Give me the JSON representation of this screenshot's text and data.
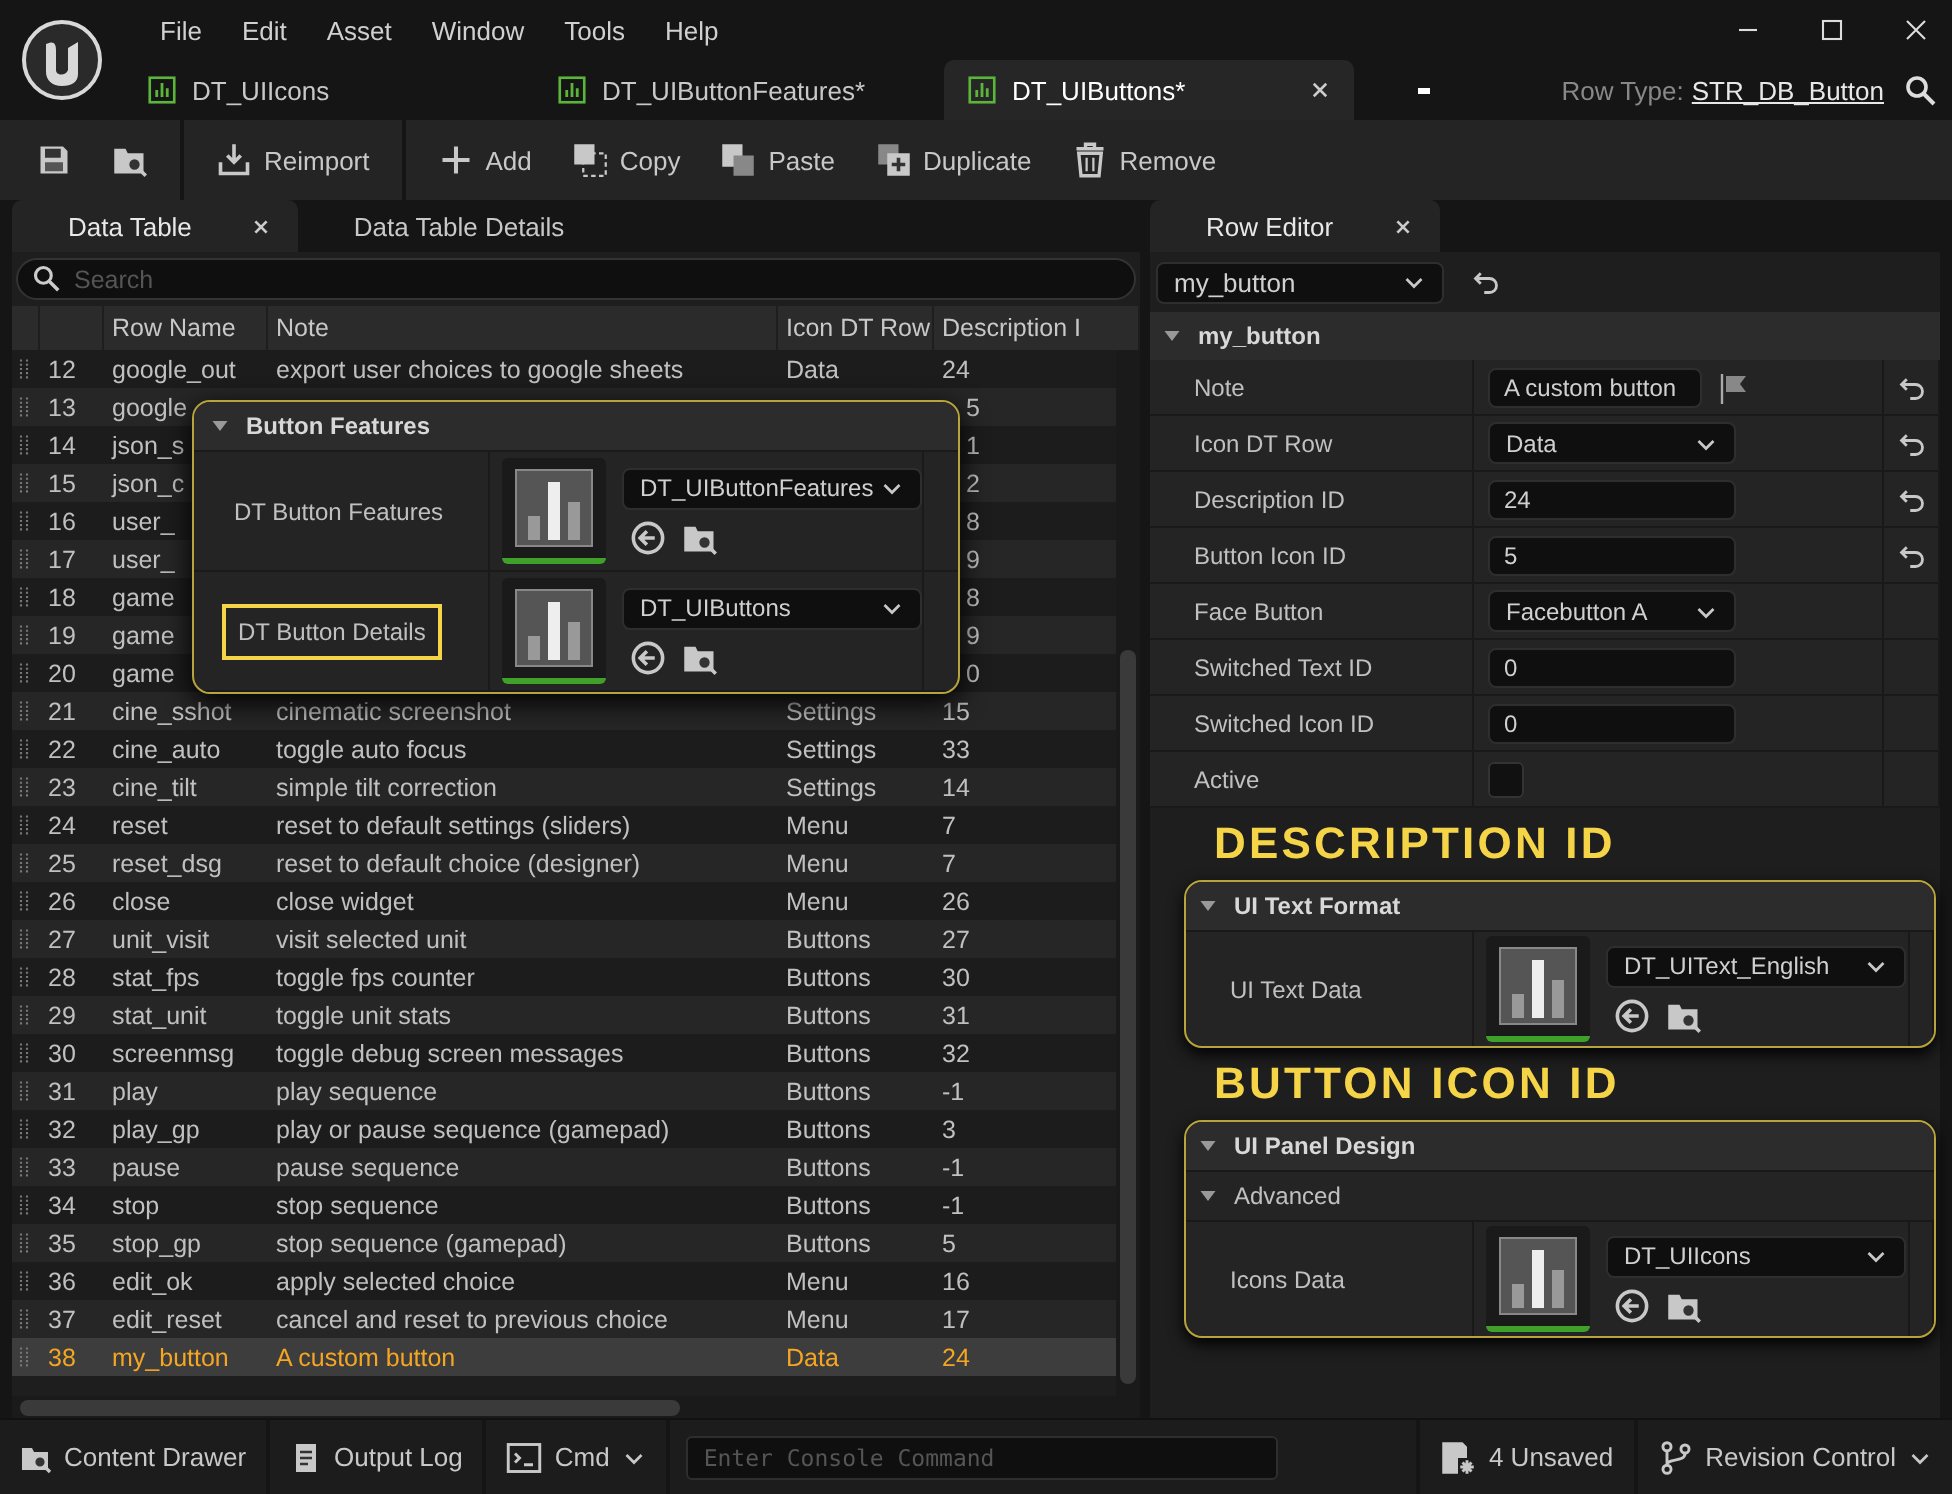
{
  "menu": [
    "File",
    "Edit",
    "Asset",
    "Window",
    "Tools",
    "Help"
  ],
  "document_tabs": [
    {
      "label": "DT_UIIcons",
      "selected": false
    },
    {
      "label": "DT_UIButtonFeatures*",
      "selected": false
    },
    {
      "label": "DT_UIButtons*",
      "selected": true
    }
  ],
  "row_type": {
    "label": "Row Type:",
    "value": "STR_DB_Button"
  },
  "toolbar": [
    {
      "kind": "save"
    },
    {
      "kind": "browse"
    },
    {
      "kind": "reimport",
      "label": "Reimport"
    },
    {
      "kind": "add",
      "label": "Add"
    },
    {
      "kind": "copy",
      "label": "Copy"
    },
    {
      "kind": "paste",
      "label": "Paste"
    },
    {
      "kind": "duplicate",
      "label": "Duplicate"
    },
    {
      "kind": "remove",
      "label": "Remove"
    }
  ],
  "data_table": {
    "tabs": [
      {
        "label": "Data Table",
        "selected": true
      },
      {
        "label": "Data Table Details",
        "selected": false
      }
    ],
    "search": {
      "placeholder": "Search"
    },
    "columns": [
      "Row Name",
      "Note",
      "Icon DT Row",
      "Description I"
    ],
    "rows": [
      {
        "number": "12",
        "name": "google_out",
        "note": "export user choices to google sheets",
        "icon_row": "Data",
        "description_id": "24",
        "selected": false
      },
      {
        "number": "13",
        "name": "google",
        "description_id": "5",
        "selected": false
      },
      {
        "number": "14",
        "name": "json_s",
        "description_id": "1",
        "selected": false
      },
      {
        "number": "15",
        "name": "json_c",
        "description_id": "2",
        "selected": false
      },
      {
        "number": "16",
        "name": "user_",
        "description_id": "8",
        "selected": false
      },
      {
        "number": "17",
        "name": "user_",
        "description_id": "9",
        "selected": false
      },
      {
        "number": "18",
        "name": "game",
        "description_id": "8",
        "selected": false
      },
      {
        "number": "19",
        "name": "game",
        "description_id": "9",
        "selected": false
      },
      {
        "number": "20",
        "name": "game",
        "description_id": "0",
        "selected": false
      },
      {
        "number": "21",
        "name": "cine_sshot",
        "note": "cinematic screenshot",
        "icon_row": "Settings",
        "description_id": "15",
        "selected": false
      },
      {
        "number": "22",
        "name": "cine_auto",
        "note": "toggle auto focus",
        "icon_row": "Settings",
        "description_id": "33",
        "selected": false
      },
      {
        "number": "23",
        "name": "cine_tilt",
        "note": "simple tilt correction",
        "icon_row": "Settings",
        "description_id": "14",
        "selected": false
      },
      {
        "number": "24",
        "name": "reset",
        "note": "reset to default settings (sliders)",
        "icon_row": "Menu",
        "description_id": "7",
        "selected": false
      },
      {
        "number": "25",
        "name": "reset_dsg",
        "note": "reset to default choice (designer)",
        "icon_row": "Menu",
        "description_id": "7",
        "selected": false
      },
      {
        "number": "26",
        "name": "close",
        "note": "close widget",
        "icon_row": "Menu",
        "description_id": "26",
        "selected": false
      },
      {
        "number": "27",
        "name": "unit_visit",
        "note": "visit selected unit",
        "icon_row": "Buttons",
        "description_id": "27",
        "selected": false
      },
      {
        "number": "28",
        "name": "stat_fps",
        "note": "toggle fps counter",
        "icon_row": "Buttons",
        "description_id": "30",
        "selected": false
      },
      {
        "number": "29",
        "name": "stat_unit",
        "note": "toggle unit stats",
        "icon_row": "Buttons",
        "description_id": "31",
        "selected": false
      },
      {
        "number": "30",
        "name": "screenmsg",
        "note": "toggle debug screen messages",
        "icon_row": "Buttons",
        "description_id": "32",
        "selected": false
      },
      {
        "number": "31",
        "name": "play",
        "note": "play sequence",
        "icon_row": "Buttons",
        "description_id": "-1",
        "selected": false
      },
      {
        "number": "32",
        "name": "play_gp",
        "note": "play or pause sequence (gamepad)",
        "icon_row": "Buttons",
        "description_id": "3",
        "selected": false
      },
      {
        "number": "33",
        "name": "pause",
        "note": "pause sequence",
        "icon_row": "Buttons",
        "description_id": "-1",
        "selected": false
      },
      {
        "number": "34",
        "name": "stop",
        "note": "stop sequence",
        "icon_row": "Buttons",
        "description_id": "-1",
        "selected": false
      },
      {
        "number": "35",
        "name": "stop_gp",
        "note": "stop sequence (gamepad)",
        "icon_row": "Buttons",
        "description_id": "5",
        "selected": false
      },
      {
        "number": "36",
        "name": "edit_ok",
        "note": "apply selected choice",
        "icon_row": "Menu",
        "description_id": "16",
        "selected": false
      },
      {
        "number": "37",
        "name": "edit_reset",
        "note": "cancel and reset to previous choice",
        "icon_row": "Menu",
        "description_id": "17",
        "selected": false
      },
      {
        "number": "38",
        "name": "my_button",
        "note": "A custom button",
        "icon_row": "Data",
        "description_id": "24",
        "selected": true
      }
    ]
  },
  "popup": {
    "title": "Button Features",
    "rows": [
      {
        "label": "DT Button Features",
        "value": "DT_UIButtonFeatures",
        "highlighted": false
      },
      {
        "label": "DT Button Details",
        "value": "DT_UIButtons",
        "highlighted": true
      }
    ]
  },
  "row_editor": {
    "tab": "Row Editor",
    "row_select": "my_button",
    "section": "my_button",
    "properties": [
      {
        "label": "Note",
        "kind": "text",
        "value": "A custom button",
        "flag": true,
        "resettable": true
      },
      {
        "label": "Icon DT Row",
        "kind": "dropdown",
        "value": "Data",
        "resettable": true
      },
      {
        "label": "Description ID",
        "kind": "text",
        "value": "24",
        "resettable": true
      },
      {
        "label": "Button Icon ID",
        "kind": "text",
        "value": "5",
        "resettable": true
      },
      {
        "label": "Face Button",
        "kind": "dropdown",
        "value": "Facebutton A",
        "resettable": false
      },
      {
        "label": "Switched Text ID",
        "kind": "text",
        "value": "0",
        "resettable": false
      },
      {
        "label": "Switched Icon ID",
        "kind": "text",
        "value": "0",
        "resettable": false
      },
      {
        "label": "Active",
        "kind": "checkbox",
        "checked": false,
        "resettable": false
      }
    ],
    "groups": [
      {
        "caption": "DESCRIPTION ID",
        "title": "UI Text Format",
        "asset_label": "UI Text Data",
        "asset": "DT_UIText_English"
      },
      {
        "caption": "BUTTON ICON ID",
        "title": "UI Panel Design",
        "subsection": "Advanced",
        "asset_label": "Icons Data",
        "asset": "DT_UIIcons"
      }
    ]
  },
  "status_bar": {
    "content_drawer": "Content Drawer",
    "output_log": "Output Log",
    "cmd": "Cmd",
    "console": {
      "placeholder": "Enter Console Command"
    },
    "unsaved": "4 Unsaved",
    "revision": "Revision Control"
  }
}
